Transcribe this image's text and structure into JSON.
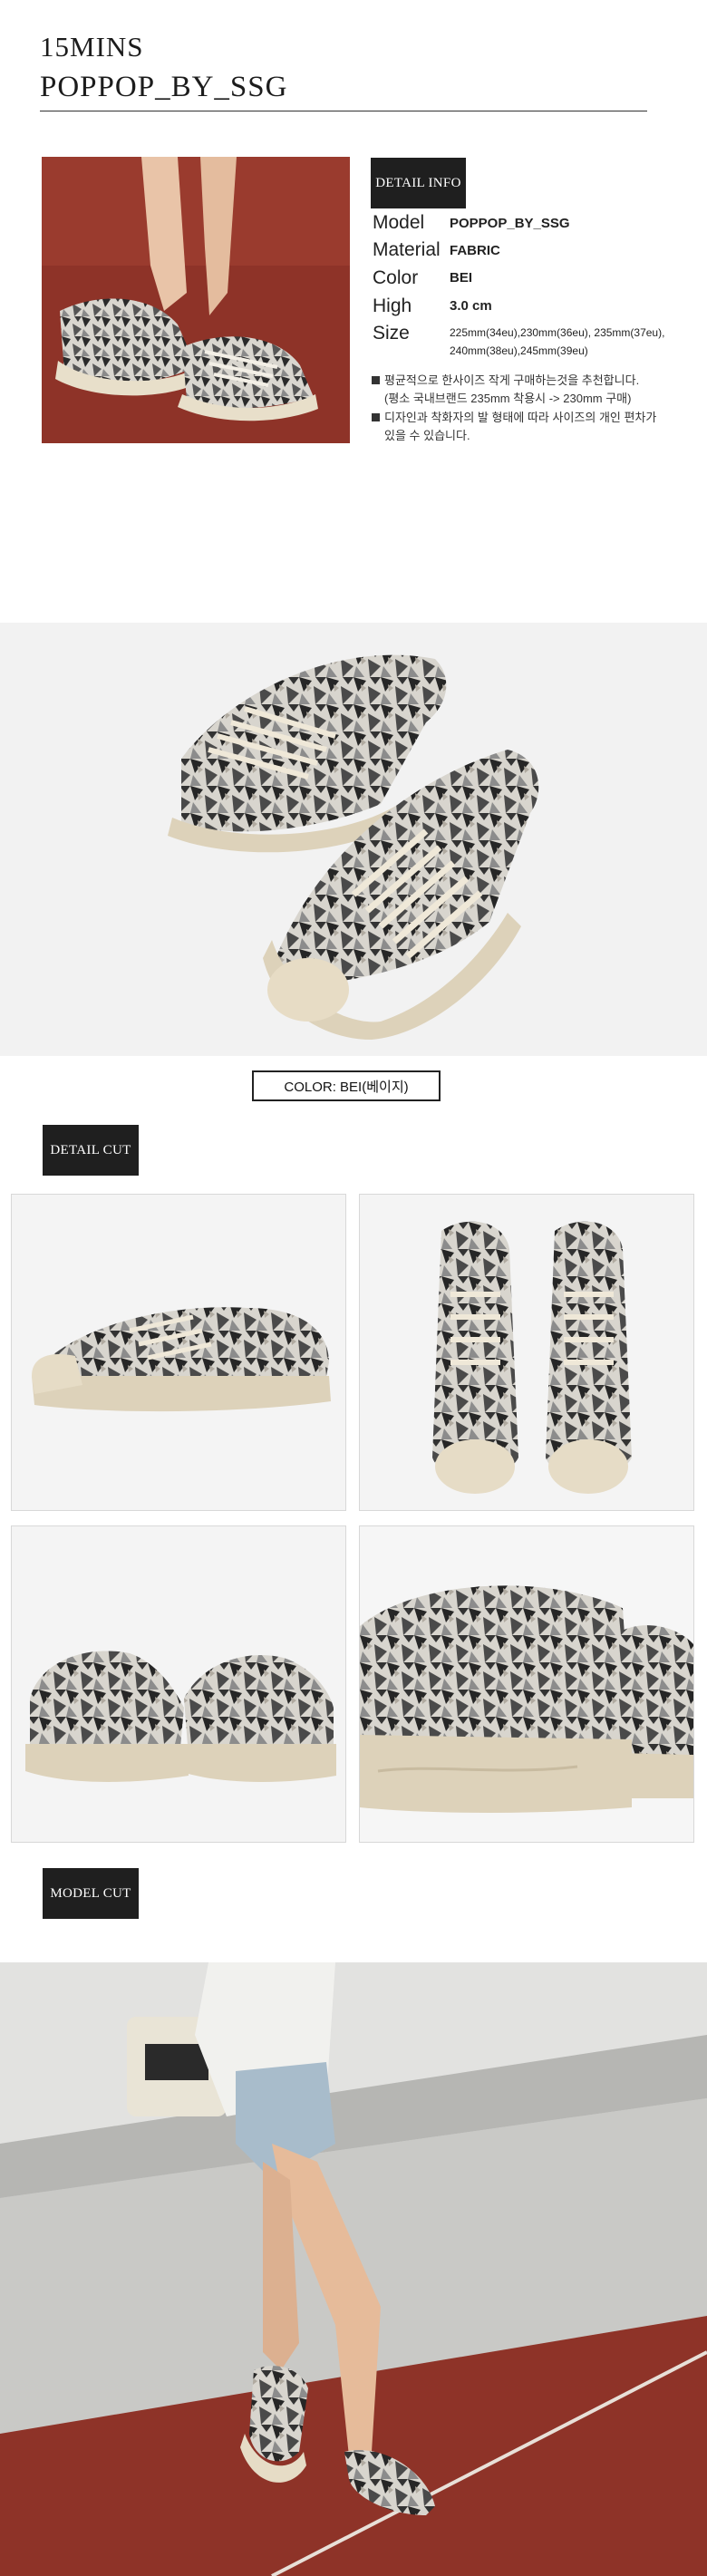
{
  "header": {
    "brand": "15MINS",
    "product_name": "POPPOP_BY_SSG"
  },
  "detail_info": {
    "label": "DETAIL INFO",
    "specs": [
      {
        "label": "Model",
        "value": "POPPOP_BY_SSG"
      },
      {
        "label": "Material",
        "value": "FABRIC"
      },
      {
        "label": "Color",
        "value": "BEI"
      },
      {
        "label": "High",
        "value": "3.0 cm"
      },
      {
        "label": "Size",
        "value_line1": "225mm(34eu),230mm(36eu), 235mm(37eu),",
        "value_line2": "240mm(38eu),245mm(39eu)"
      }
    ],
    "notes": [
      {
        "line1": "평균적으로 한사이즈 작게 구매하는것을 추천합니다.",
        "line2": "(평소 국내브랜드 235mm 착용시 -> 230mm 구매)"
      },
      {
        "line1": "디자인과 착화자의 발 형태에 따라 사이즈의 개인 편차가",
        "line2": "있을 수 있습니다."
      }
    ]
  },
  "color_caption": "COLOR:  BEI(베이지)",
  "sections": {
    "detail_cut": "DETAIL CUT",
    "model_cut": "MODEL CUT"
  },
  "colors": {
    "label_bg": "#1f1f1f",
    "track_red": "#8e3328",
    "sole_cream": "#e6dcc6",
    "print_dark": "#2c2c2c"
  }
}
